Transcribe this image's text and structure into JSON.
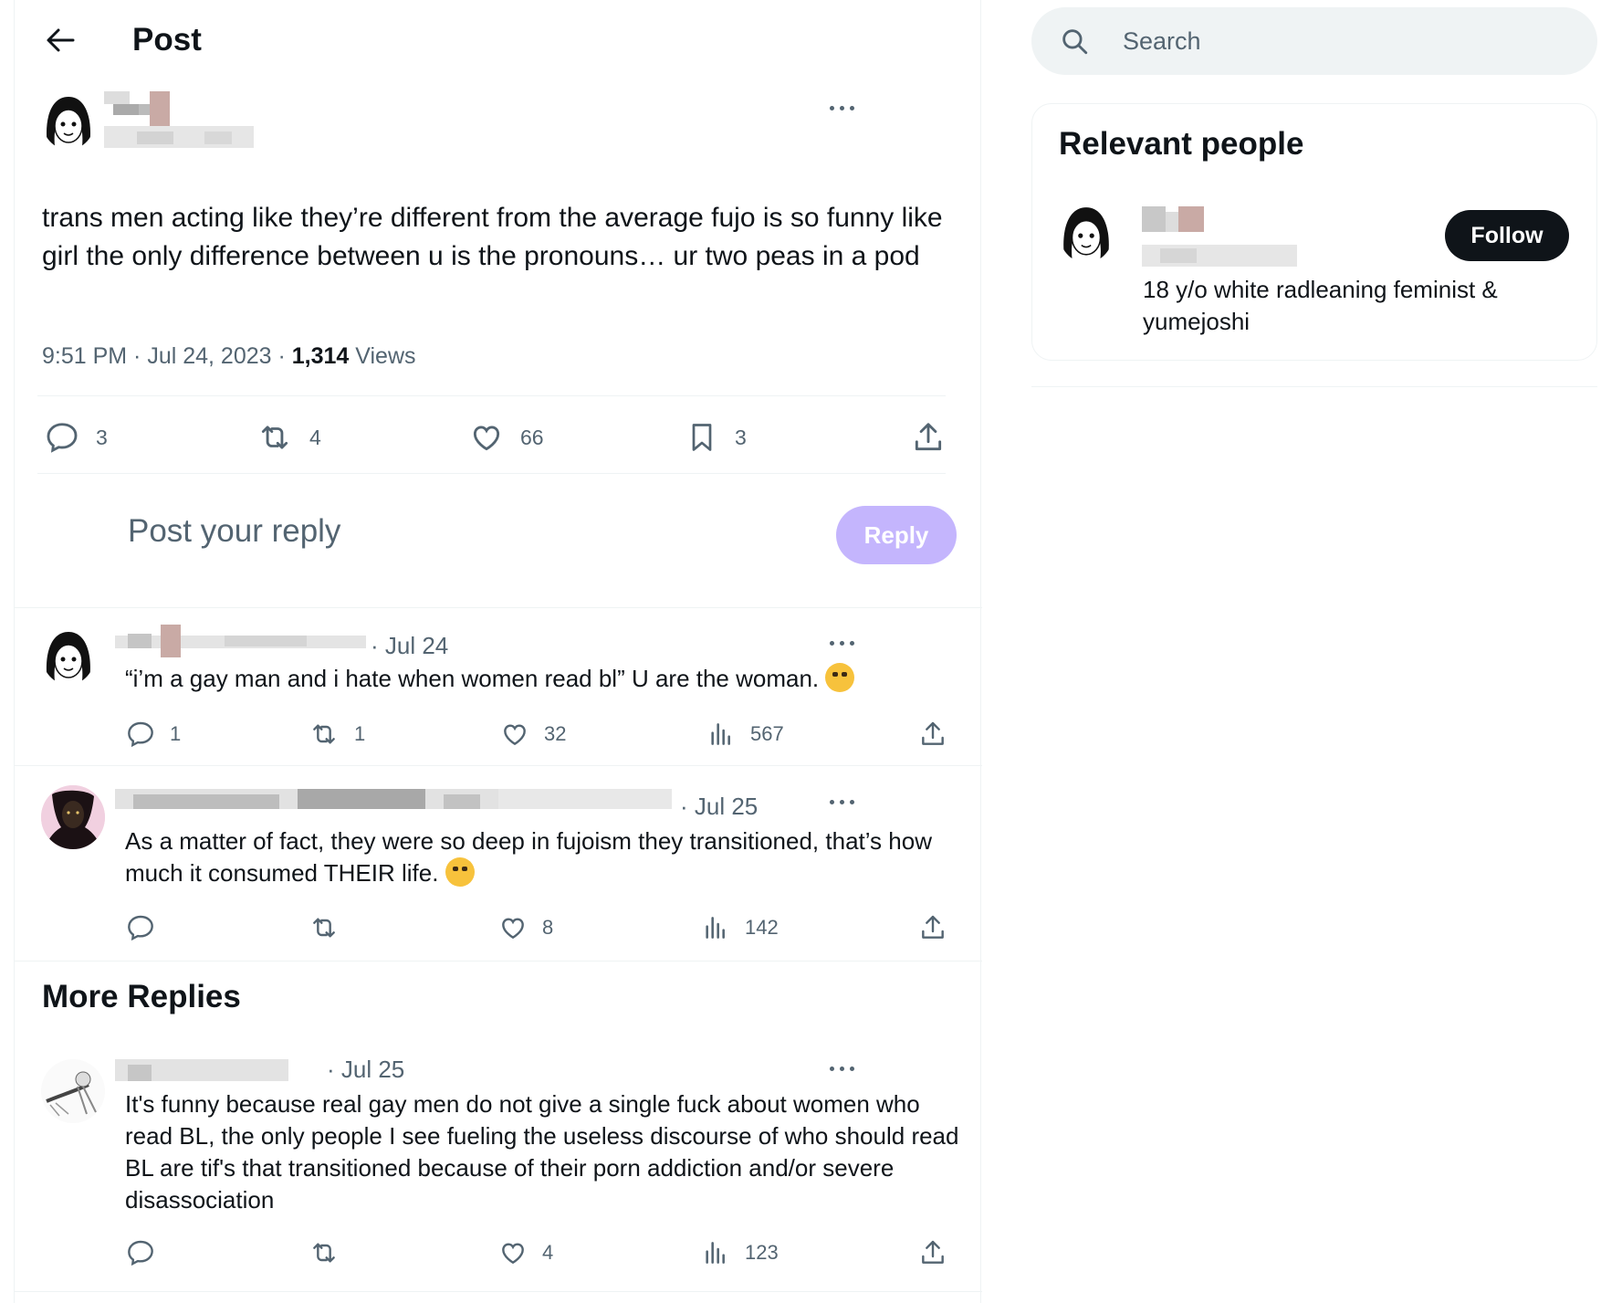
{
  "header": {
    "title": "Post"
  },
  "post": {
    "text": "trans men acting like they’re different from the average fujo is so funny like girl the only difference between u is the pronouns… ur two peas in a pod",
    "time": "9:51 PM · Jul 24, 2023 · ",
    "views_count": "1,314",
    "views_label": " Views",
    "stats": {
      "replies": "3",
      "reposts": "4",
      "likes": "66",
      "bookmarks": "3"
    }
  },
  "composer": {
    "placeholder": "Post your reply",
    "reply_label": "Reply"
  },
  "replies": [
    {
      "date": "· Jul 24",
      "text": "“i’m a gay man and i hate when women read bl” U are the woman.",
      "emoji": "loudly-crying-face",
      "replies": "1",
      "reposts": "1",
      "likes": "32",
      "views": "567"
    },
    {
      "date": "· Jul 25",
      "text": "As a matter of fact, they were so deep in fujoism they transitioned, that’s how much it consumed THEIR life.",
      "emoji": "rolling-on-floor-laughing-face",
      "replies": "",
      "reposts": "",
      "likes": "8",
      "views": "142"
    }
  ],
  "more_replies": {
    "title": "More Replies",
    "items": [
      {
        "date": "· Jul 25",
        "text": "It's funny because real gay men do not give a single fuck about women who read BL, the only people I see fueling the useless discourse of who should read BL are tif's that transitioned because of their porn addiction and/or severe disassociation",
        "replies": "",
        "reposts": "",
        "likes": "4",
        "views": "123"
      }
    ]
  },
  "sidebar": {
    "search_placeholder": "Search",
    "relevant_people": {
      "title": "Relevant people",
      "follow_label": "Follow",
      "bio": "18 y/o white radleaning feminist & yumejoshi"
    }
  },
  "colors": {
    "accent_disabled": "#c4b5fd",
    "text_secondary": "#536471",
    "border": "#eff3f4"
  }
}
